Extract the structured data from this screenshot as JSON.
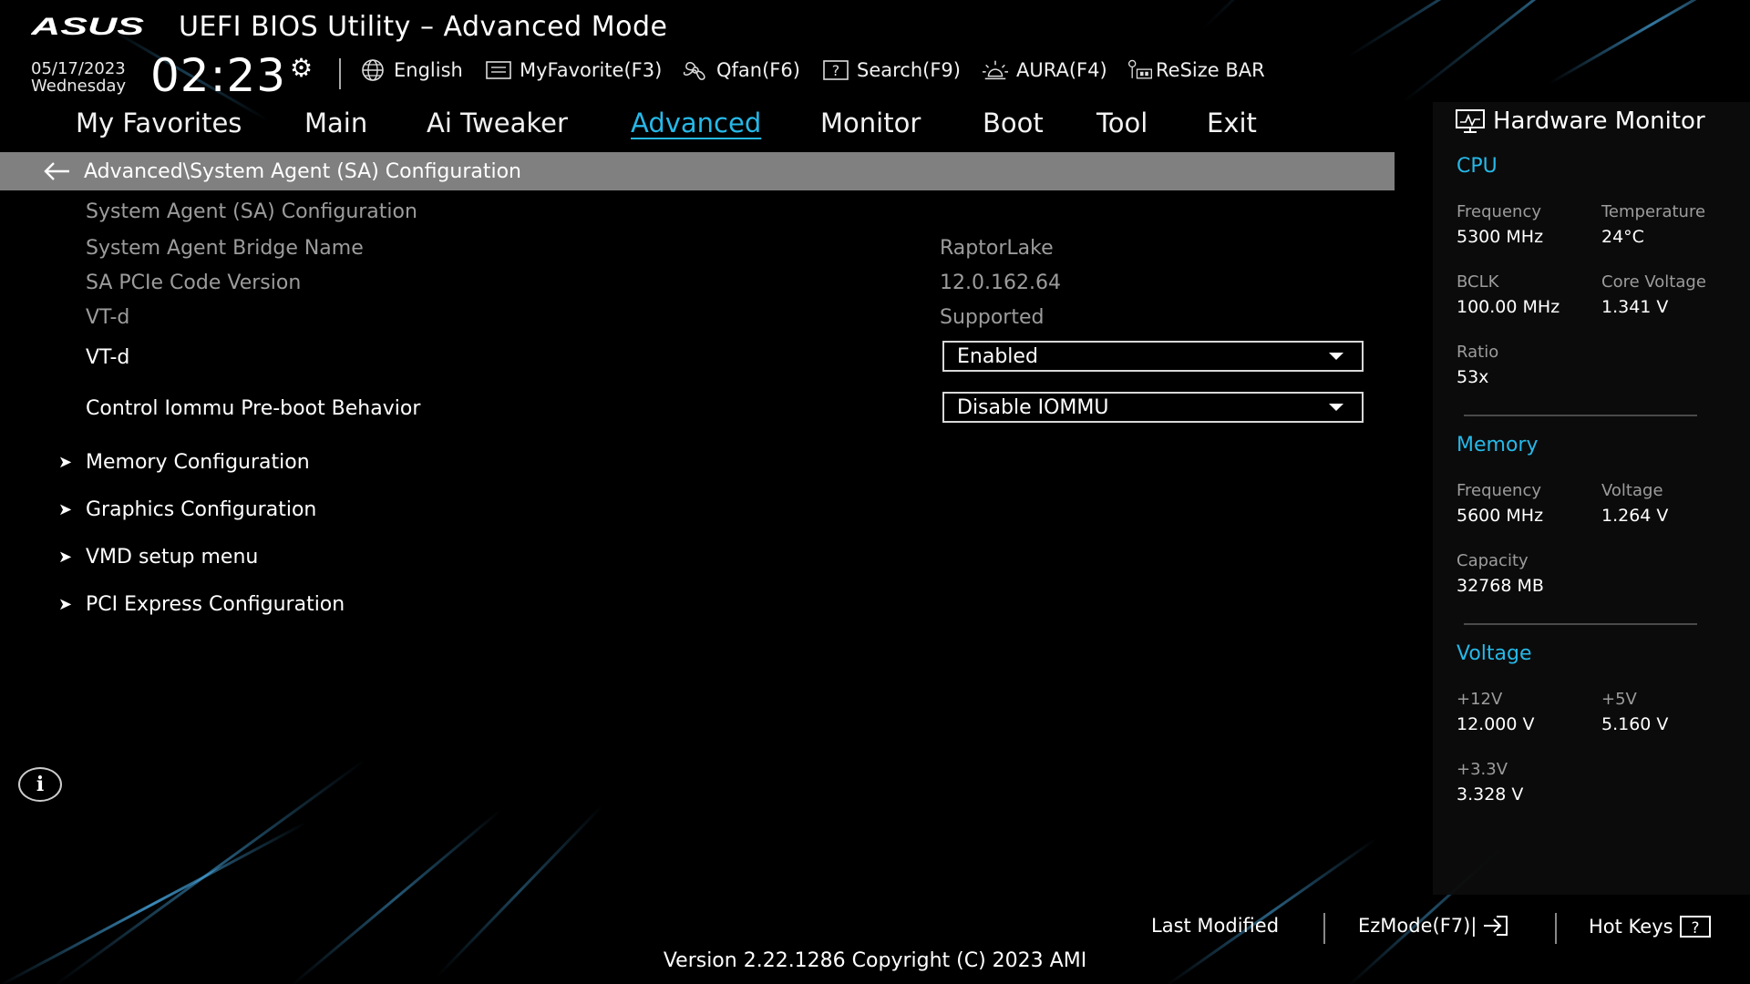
{
  "header": {
    "logo_text": "ASUS",
    "title": "UEFI BIOS Utility – Advanced Mode",
    "date": "05/17/2023",
    "weekday": "Wednesday",
    "time": "02:23",
    "toolbar": [
      {
        "label": "English",
        "icon": "globe-icon"
      },
      {
        "label": "MyFavorite(F3)",
        "icon": "favorite-icon"
      },
      {
        "label": "Qfan(F6)",
        "icon": "fan-icon"
      },
      {
        "label": "Search(F9)",
        "icon": "search-help-icon"
      },
      {
        "label": "AURA(F4)",
        "icon": "aura-light-icon"
      },
      {
        "label": "ReSize BAR",
        "icon": "resize-bar-icon"
      }
    ]
  },
  "nav": {
    "tabs": [
      "My Favorites",
      "Main",
      "Ai Tweaker",
      "Advanced",
      "Monitor",
      "Boot",
      "Tool",
      "Exit"
    ],
    "active": "Advanced"
  },
  "breadcrumb": "Advanced\\System Agent (SA) Configuration",
  "settings": {
    "section_title": "System Agent (SA) Configuration",
    "info": [
      {
        "label": "System Agent Bridge Name",
        "value": "RaptorLake"
      },
      {
        "label": "SA PCIe Code Version",
        "value": "12.0.162.64"
      },
      {
        "label": "VT-d",
        "value": "Supported"
      }
    ],
    "options": [
      {
        "label": "VT-d",
        "value": "Enabled"
      },
      {
        "label": "Control Iommu Pre-boot Behavior",
        "value": "Disable IOMMU"
      }
    ],
    "submenus": [
      "Memory Configuration",
      "Graphics Configuration",
      "VMD setup menu",
      "PCI Express Configuration"
    ]
  },
  "hardware_monitor": {
    "title": "Hardware Monitor",
    "cpu": {
      "heading": "CPU",
      "frequency_label": "Frequency",
      "frequency": "5300 MHz",
      "temperature_label": "Temperature",
      "temperature": "24°C",
      "bclk_label": "BCLK",
      "bclk": "100.00 MHz",
      "core_voltage_label": "Core Voltage",
      "core_voltage": "1.341 V",
      "ratio_label": "Ratio",
      "ratio": "53x"
    },
    "memory": {
      "heading": "Memory",
      "frequency_label": "Frequency",
      "frequency": "5600 MHz",
      "voltage_label": "Voltage",
      "voltage": "1.264 V",
      "capacity_label": "Capacity",
      "capacity": "32768 MB"
    },
    "voltage": {
      "heading": "Voltage",
      "v12_label": "+12V",
      "v12": "12.000 V",
      "v5_label": "+5V",
      "v5": "5.160 V",
      "v33_label": "+3.3V",
      "v33": "3.328 V"
    }
  },
  "footer": {
    "last_modified": "Last Modified",
    "ezmode": "EzMode(F7)|",
    "hotkeys": "Hot Keys",
    "version": "Version 2.22.1286 Copyright (C) 2023 AMI"
  },
  "colors": {
    "accent": "#26b8e8",
    "dim_text": "#9c9c9c",
    "breadcrumb_bg": "#808080"
  }
}
